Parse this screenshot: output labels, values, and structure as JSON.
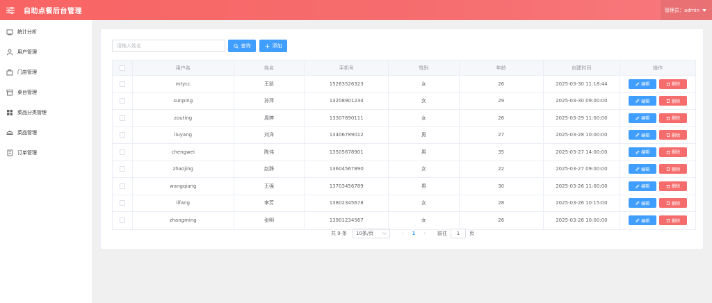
{
  "header": {
    "title": "自助点餐后台管理",
    "user_label": "管理员：admin"
  },
  "sidebar": {
    "items": [
      {
        "label": "统计分析",
        "icon": "stats-icon"
      },
      {
        "label": "用户管理",
        "icon": "user-icon"
      },
      {
        "label": "门店管理",
        "icon": "store-icon"
      },
      {
        "label": "桌台管理",
        "icon": "table-icon"
      },
      {
        "label": "菜品分类管理",
        "icon": "category-grid-icon"
      },
      {
        "label": "菜品管理",
        "icon": "dish-icon"
      },
      {
        "label": "订单管理",
        "icon": "order-icon"
      }
    ]
  },
  "toolbar": {
    "search_placeholder": "请输入姓名",
    "query_label": "查询",
    "add_label": "添加"
  },
  "table": {
    "headers": [
      "用户名",
      "姓名",
      "手机号",
      "性别",
      "年龄",
      "创建时间",
      "操作"
    ],
    "edit_label": "编辑",
    "delete_label": "删除",
    "rows": [
      [
        "mtycc",
        "王凯",
        "15263526323",
        "女",
        "26",
        "2025-03-30 11:18:44"
      ],
      [
        "sunping",
        "孙萍",
        "13208901234",
        "女",
        "29",
        "2025-03-30 09:00:00"
      ],
      [
        "zouting",
        "周婷",
        "13307890111",
        "女",
        "26",
        "2025-03-29 11:00:00"
      ],
      [
        "liuyang",
        "刘洋",
        "13406789012",
        "男",
        "27",
        "2025-03-28 10:00:00"
      ],
      [
        "chengwei",
        "陈伟",
        "13505678901",
        "男",
        "35",
        "2025-03-27 14:00:00"
      ],
      [
        "zhaojing",
        "赵静",
        "13604567890",
        "女",
        "22",
        "2025-03-27 09:00:00"
      ],
      [
        "wangqiang",
        "王强",
        "13703456789",
        "男",
        "30",
        "2025-03-26 11:00:00"
      ],
      [
        "lifang",
        "李芳",
        "13802345678",
        "女",
        "28",
        "2025-03-26 10:15:00"
      ],
      [
        "zhangming",
        "张明",
        "13901234567",
        "女",
        "26",
        "2025-03-26 10:00:00"
      ]
    ]
  },
  "pagination": {
    "total_label": "共 9 条",
    "page_size": "10条/页",
    "current_page": "1",
    "goto_label": "前往",
    "goto_value": "1",
    "goto_suffix": "页"
  },
  "colors": {
    "header_start": "#f86463",
    "primary": "#409eff",
    "danger": "#f56c6c"
  }
}
